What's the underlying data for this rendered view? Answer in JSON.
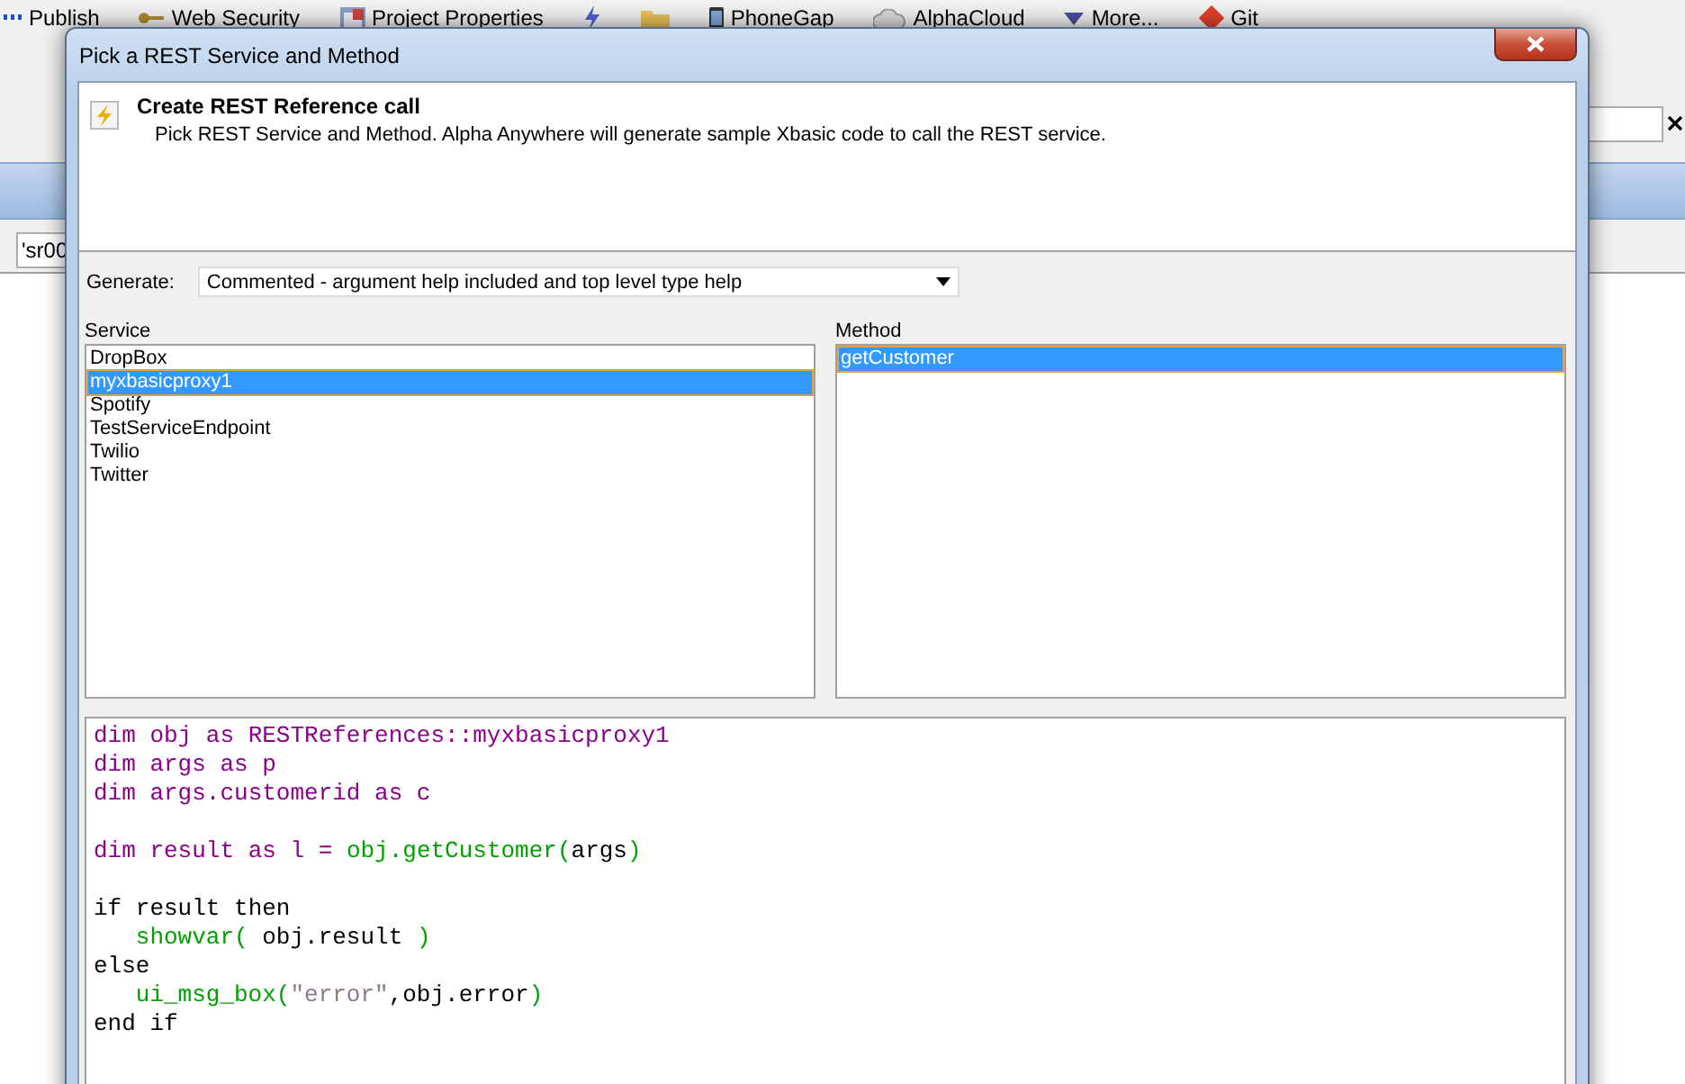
{
  "app_toolbar": [
    {
      "kind": "dots",
      "label": "Publish"
    },
    {
      "kind": "key",
      "label": "Web Security"
    },
    {
      "kind": "properties",
      "label": "Project Properties"
    },
    {
      "kind": "lightning"
    },
    {
      "kind": "folder"
    },
    {
      "kind": "phone",
      "label": "PhoneGap"
    },
    {
      "kind": "cloud",
      "label": "AlphaCloud"
    },
    {
      "kind": "caret",
      "label": "More..."
    },
    {
      "kind": "git",
      "label": "Git"
    }
  ],
  "app_field": {
    "value": "'sr00"
  },
  "dialog": {
    "title": "Pick a REST Service and Method",
    "header": {
      "title": "Create REST Reference call",
      "description": "Pick REST Service and Method. Alpha Anywhere will generate sample Xbasic code to call the REST service."
    },
    "generate": {
      "label": "Generate:",
      "value": "Commented - argument help included and top level type help"
    },
    "service": {
      "label": "Service",
      "items": [
        {
          "label": "DropBox",
          "selected": false
        },
        {
          "label": "myxbasicproxy1",
          "selected": true
        },
        {
          "label": "Spotify",
          "selected": false
        },
        {
          "label": "TestServiceEndpoint",
          "selected": false
        },
        {
          "label": "Twilio",
          "selected": false
        },
        {
          "label": "Twitter",
          "selected": false
        }
      ]
    },
    "method": {
      "label": "Method",
      "items": [
        {
          "label": "getCustomer",
          "selected": true
        }
      ]
    },
    "code": [
      {
        "kind": "code",
        "indented": false,
        "segments": [
          {
            "kind": "keyword",
            "text": "dim obj as RESTReferences::myxbasicproxy1"
          }
        ]
      },
      {
        "kind": "code",
        "indented": false,
        "segments": [
          {
            "kind": "keyword",
            "text": "dim args as p"
          }
        ]
      },
      {
        "kind": "code",
        "indented": false,
        "segments": [
          {
            "kind": "keyword",
            "text": "dim args.customerid as c"
          }
        ]
      },
      {
        "kind": "blank"
      },
      {
        "kind": "code",
        "indented": false,
        "segments": [
          {
            "kind": "keyword",
            "text": "dim result as l = "
          },
          {
            "kind": "function",
            "text": "obj.getCustomer("
          },
          {
            "kind": "plain",
            "text": "args"
          },
          {
            "kind": "function",
            "text": ")"
          }
        ]
      },
      {
        "kind": "blank"
      },
      {
        "kind": "code",
        "indented": false,
        "segments": [
          {
            "kind": "plain",
            "text": "if result then"
          }
        ]
      },
      {
        "kind": "code",
        "indented": true,
        "segments": [
          {
            "kind": "function",
            "text": "showvar("
          },
          {
            "kind": "plain",
            "text": " obj.result "
          },
          {
            "kind": "function",
            "text": ")"
          }
        ]
      },
      {
        "kind": "code",
        "indented": false,
        "segments": [
          {
            "kind": "plain",
            "text": "else"
          }
        ]
      },
      {
        "kind": "code",
        "indented": true,
        "segments": [
          {
            "kind": "function",
            "text": "ui_msg_box("
          },
          {
            "kind": "string",
            "text": "\"error\""
          },
          {
            "kind": "plain",
            "text": ",obj.error"
          },
          {
            "kind": "function",
            "text": ")"
          }
        ]
      },
      {
        "kind": "code",
        "indented": false,
        "segments": [
          {
            "kind": "plain",
            "text": "end if"
          }
        ]
      }
    ]
  }
}
